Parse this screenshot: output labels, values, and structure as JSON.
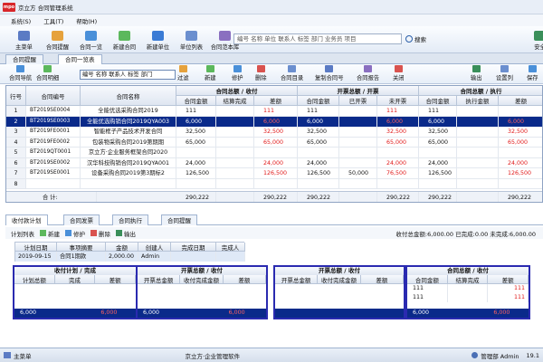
{
  "window": {
    "title": "京立方 合同管理系统",
    "logo": "mpo"
  },
  "menu": [
    "系统(S)",
    "工具(T)",
    "帮助(H)"
  ],
  "toolbar": [
    {
      "label": "主菜单",
      "icon": "home-icon",
      "color": "#5b7bc4"
    },
    {
      "label": "合同提醒",
      "icon": "bell-icon",
      "color": "#e6a23c"
    },
    {
      "label": "合同一览",
      "icon": "list-icon",
      "color": "#4a90d9"
    },
    {
      "label": "新建合同",
      "icon": "new-doc-icon",
      "color": "#5cb85c"
    },
    {
      "label": "新建单位",
      "icon": "building-icon",
      "color": "#3a7bd5"
    },
    {
      "label": "单位列表",
      "icon": "table-icon",
      "color": "#6b8fcf"
    },
    {
      "label": "合同范本库",
      "icon": "book-icon",
      "color": "#8a6fc0"
    },
    {
      "label": "安全",
      "icon": "shield-icon",
      "color": "#3a8f5a"
    }
  ],
  "search": {
    "placeholder": "编号 名称 单位 联系人 标签 部门 业务员 项目",
    "button": "搜索"
  },
  "tabs": [
    "合同提醒",
    "合同一览表"
  ],
  "subtoolbar": {
    "left": [
      {
        "label": "合同导航",
        "color": "#4a90d9"
      },
      {
        "label": "合同明细",
        "color": "#5cb85c"
      }
    ],
    "filter": "编号 名称 联系人 标签 部门",
    "mid": [
      {
        "label": "过滤",
        "color": "#e6a23c"
      },
      {
        "label": "新建",
        "color": "#5cb85c"
      },
      {
        "label": "修护",
        "color": "#4a90d9"
      },
      {
        "label": "删除",
        "color": "#d9534f"
      },
      {
        "label": "合同目录",
        "color": "#6b8fcf"
      },
      {
        "label": "复制合同号",
        "color": "#5b7bc4"
      },
      {
        "label": "合同报告",
        "color": "#8a6fc0"
      },
      {
        "label": "关闭",
        "color": "#d9534f"
      }
    ],
    "right": [
      {
        "label": "输出",
        "color": "#3a8f5a"
      },
      {
        "label": "设置列",
        "color": "#6b8fcf"
      },
      {
        "label": "保存",
        "color": "#4a90d9"
      }
    ]
  },
  "grid": {
    "groups": [
      "合同总额 / 收付",
      "开票总额 / 开票",
      "合同总额 / 执行"
    ],
    "columns": [
      "行号",
      "合同编号",
      "合同名称",
      "合同金额",
      "结算完成",
      "差额",
      "合同金额",
      "已开票",
      "未开票",
      "合同金额",
      "执行金额",
      "差额"
    ],
    "rows": [
      {
        "no": "1",
        "code": "BT2019SE0004",
        "name": "全能优选采购合同2019",
        "v": [
          "111",
          "",
          "111",
          "111",
          "",
          "111",
          "111",
          "",
          ""
        ],
        "red": [
          2,
          5
        ],
        "sel": false
      },
      {
        "no": "2",
        "code": "BT2019SE0003",
        "name": "全能优选购销合同2019QYA003",
        "v": [
          "6,000",
          "",
          "6,000",
          "6,000",
          "",
          "6,000",
          "6,000",
          "",
          "6,000"
        ],
        "red": [
          2,
          5,
          8
        ],
        "sel": true
      },
      {
        "no": "3",
        "code": "BT2019FE0001",
        "name": "智能框子产品技术开发合同",
        "v": [
          "32,500",
          "",
          "32,500",
          "32,500",
          "",
          "32,500",
          "32,500",
          "",
          "32,500"
        ],
        "red": [
          2,
          5,
          8
        ],
        "sel": false
      },
      {
        "no": "4",
        "code": "BT2019FE0002",
        "name": "包装物采购合同2019第期期",
        "v": [
          "65,000",
          "",
          "65,000",
          "65,000",
          "",
          "65,000",
          "65,000",
          "",
          "65,000"
        ],
        "red": [
          2,
          5,
          8
        ],
        "sel": false
      },
      {
        "no": "5",
        "code": "BT2019QT0001",
        "name": "京立方·企业服务框架合同2020",
        "v": [
          "",
          "",
          "",
          "",
          "",
          "",
          "",
          "",
          ""
        ],
        "red": [],
        "sel": false
      },
      {
        "no": "6",
        "code": "BT2019SE0002",
        "name": "汉华科技购销合同2019QYA001",
        "v": [
          "24,000",
          "",
          "24,000",
          "24,000",
          "",
          "24,000",
          "24,000",
          "",
          "24,000"
        ],
        "red": [
          2,
          5,
          8
        ],
        "sel": false
      },
      {
        "no": "7",
        "code": "BT2019SE0001",
        "name": "设备采购合同2019第3期标2",
        "v": [
          "126,500",
          "",
          "126,500",
          "126,500",
          "50,000",
          "76,500",
          "126,500",
          "",
          "126,500"
        ],
        "red": [
          2,
          5,
          8
        ],
        "sel": false
      },
      {
        "no": "8",
        "code": "",
        "name": "",
        "v": [
          "",
          "",
          "",
          "",
          "",
          "",
          "",
          "",
          ""
        ],
        "red": [],
        "sel": false
      }
    ],
    "total": {
      "label": "合 计:",
      "v": [
        "290,222",
        "",
        "290,222",
        "290,222",
        "",
        "290,222",
        "290,222",
        "",
        "290,222"
      ]
    }
  },
  "bottomTabs": [
    "收付款计划",
    "合同发票",
    "合同执行",
    "合同提醒"
  ],
  "listbar": {
    "title": "计划列表",
    "buttons": [
      "新建",
      "修护",
      "删除",
      "输出"
    ],
    "summary": "收付总金额:6,000.00 已完成:0.00 未完成:6,000.00"
  },
  "plan": {
    "headers": [
      "计划日期",
      "事项摘要",
      "金额",
      "创建人",
      "完成日期",
      "完成人"
    ],
    "row": [
      "2019-09-15",
      "合同1期款",
      "2,000.00",
      "Admin",
      "",
      ""
    ]
  },
  "panel1": {
    "title": "收付计划 / 完成",
    "cols": [
      "计划总额",
      "完成",
      "差额"
    ],
    "foot": [
      "6,000",
      "",
      "6,000"
    ]
  },
  "panel2": {
    "title": "开票总额 / 收付",
    "cols": [
      "开票总金额",
      "收付完成金额",
      "差额"
    ],
    "foot": [
      "6,000",
      "",
      "6,000"
    ]
  },
  "panel3": {
    "title": "开票总额 / 收付",
    "cols": [
      "开票总金额",
      "收付完成金额",
      "差额"
    ],
    "foot": [
      "",
      "",
      ""
    ]
  },
  "panel4": {
    "title": "合同总额 / 收付",
    "cols": [
      "合同金额",
      "结算完成",
      "差额"
    ],
    "rows": [
      [
        "111",
        "",
        "111"
      ],
      [
        "111",
        "",
        "111"
      ]
    ],
    "foot": [
      "6,000",
      "",
      "6,000"
    ]
  },
  "status": {
    "menu": "主菜单",
    "app": "京立方·企业管理软件",
    "user": "管理部 Admin",
    "ver": "19.1"
  }
}
